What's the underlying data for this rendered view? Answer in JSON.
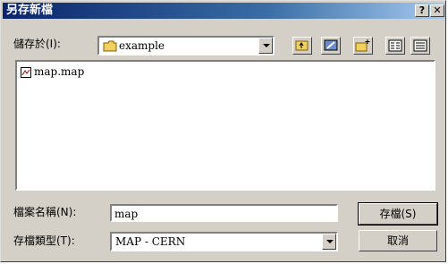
{
  "window": {
    "title": "另存新檔"
  },
  "titlebar_buttons": {
    "help": "?",
    "close": "✕"
  },
  "save_in": {
    "label": "儲存於(I):",
    "value": "example"
  },
  "files": [
    {
      "name": "map.map"
    }
  ],
  "file_name": {
    "label": "檔案名稱(N):",
    "value": "map"
  },
  "file_type": {
    "label": "存檔類型(T):",
    "value": "MAP - CERN"
  },
  "buttons": {
    "save": "存檔(S)",
    "cancel": "取消"
  },
  "colors": {
    "title_start": "#0a246a",
    "title_end": "#a6caf0",
    "face": "#d4d0c8"
  }
}
